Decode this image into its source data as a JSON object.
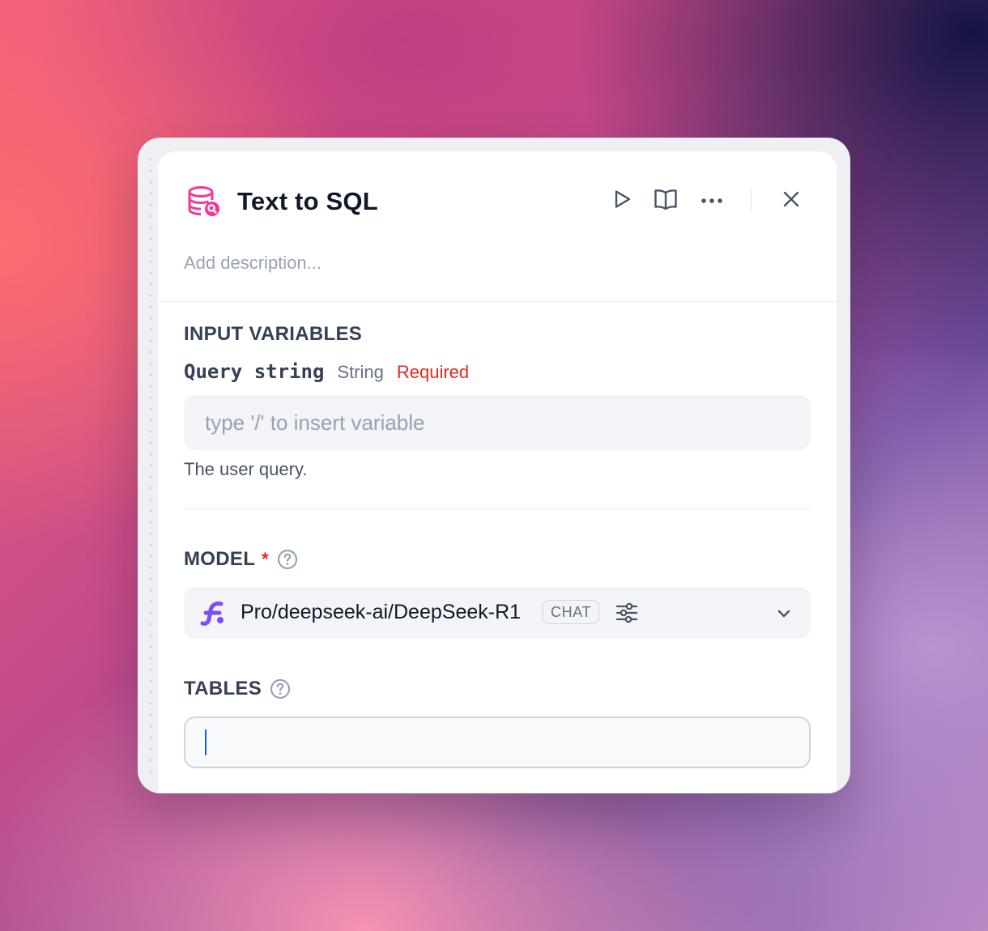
{
  "node": {
    "title": "Text to SQL",
    "icon": "database-search-icon",
    "accent_color": "#f0389b",
    "description_placeholder": "Add description...",
    "actions": [
      "run-icon",
      "docs-book-icon",
      "more-dots-icon",
      "close-icon"
    ]
  },
  "input_variables": {
    "section_label": "INPUT VARIABLES",
    "variables": [
      {
        "name": "Query string",
        "type": "String",
        "required_label": "Required",
        "placeholder": "type '/' to insert variable",
        "value": "",
        "help": "The user query."
      }
    ]
  },
  "model": {
    "label": "MODEL",
    "required_mark": "*",
    "value": "Pro/deepseek-ai/DeepSeek-R1",
    "tag": "CHAT",
    "provider_icon": "siliconflow-logo-icon",
    "logo_color": "#7c4dff"
  },
  "tables": {
    "label": "TABLES",
    "value": ""
  }
}
